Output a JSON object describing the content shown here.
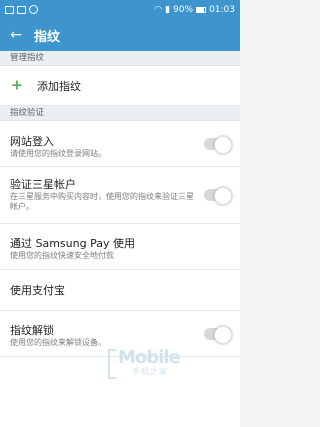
{
  "status_bar": {
    "battery_percent": "90%",
    "time": "01:03"
  },
  "app_bar": {
    "title": "指纹"
  },
  "sections": {
    "manage": {
      "header": "管理指纹",
      "add_label": "添加指纹"
    },
    "verify": {
      "header": "指纹验证",
      "items": [
        {
          "title": "网站登入",
          "subtitle": "请使用您的指纹登录网站。",
          "toggle": false
        },
        {
          "title": "验证三星帐户",
          "subtitle": "在三星服务中购买内容时，使用您的指纹来验证三星帐户。",
          "toggle": false
        },
        {
          "title": "通过 Samsung Pay 使用",
          "subtitle": "使用您的指纹快速安全地付款"
        },
        {
          "title": "使用支付宝"
        },
        {
          "title": "指纹解锁",
          "subtitle": "使用您的指纹来解锁设备。",
          "toggle": false
        }
      ]
    }
  },
  "watermark": {
    "main": "Mobile",
    "sub": "手机之家"
  },
  "colors": {
    "primary": "#3e95cd",
    "add_icon": "#4caf50",
    "toggle_off": "#d8d8d8"
  },
  "icons": {
    "back": "back-arrow-icon",
    "add": "plus-icon"
  }
}
